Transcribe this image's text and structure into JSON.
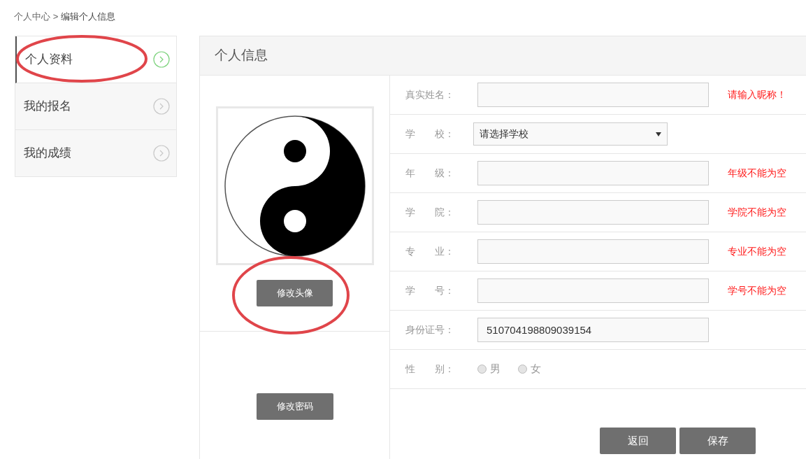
{
  "breadcrumb": {
    "parent": "个人中心",
    "separator": ">",
    "current": "编辑个人信息"
  },
  "sidebar": {
    "items": [
      {
        "label": "个人资料",
        "selected": true
      },
      {
        "label": "我的报名",
        "selected": false
      },
      {
        "label": "我的成绩",
        "selected": false
      }
    ]
  },
  "panel": {
    "title": "个人信息",
    "avatar_button": "修改头像",
    "password_button": "修改密码"
  },
  "form": {
    "rows": [
      {
        "kind": "input",
        "label": "真实姓名：",
        "error": "请输入昵称！"
      },
      {
        "kind": "select",
        "label": "学　　校：",
        "value": "请选择学校"
      },
      {
        "kind": "input",
        "label": "年　　级：",
        "error": "年级不能为空"
      },
      {
        "kind": "input",
        "label": "学　　院：",
        "error": "学院不能为空"
      },
      {
        "kind": "input",
        "label": "专　　业：",
        "error": "专业不能为空"
      },
      {
        "kind": "input",
        "label": "学　　号：",
        "error": "学号不能为空"
      },
      {
        "kind": "input",
        "label": "身份证号：",
        "value": "510704198809039154"
      },
      {
        "kind": "radio",
        "label": "性　　别：",
        "options": [
          {
            "label": "男",
            "selected": false
          },
          {
            "label": "女",
            "selected": false
          }
        ]
      }
    ],
    "buttons": [
      "返回",
      "保存"
    ]
  }
}
